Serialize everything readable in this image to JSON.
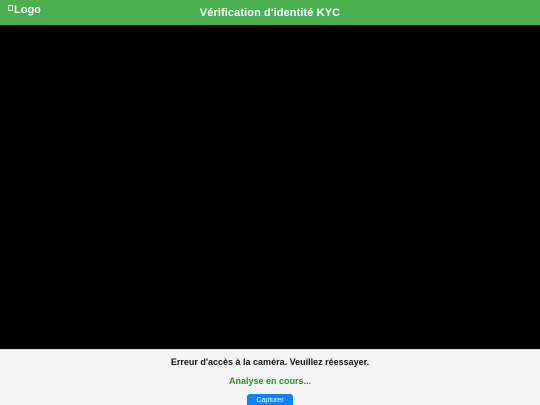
{
  "header": {
    "logo_alt": "Logo",
    "title": "Vérification d'identité KYC"
  },
  "camera": {
    "error_message": "Erreur d'accès à la caméra. Veuillez réessayer.",
    "status_message": "Analyse en cours...",
    "capture_label": "Capturer"
  },
  "icons": {
    "logo": "broken-image-icon"
  },
  "colors": {
    "header_bg": "#4caf50",
    "status_green": "#2e8b2e",
    "button_blue": "#0a84ff",
    "video_bg": "#000000",
    "footer_bg": "#f4f4f4"
  }
}
